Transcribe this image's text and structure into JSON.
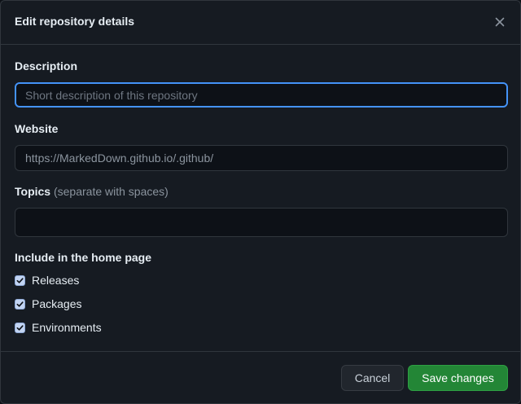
{
  "dialog": {
    "title": "Edit repository details"
  },
  "form": {
    "description": {
      "label": "Description",
      "value": "",
      "placeholder": "Short description of this repository"
    },
    "website": {
      "label": "Website",
      "value": "https://MarkedDown.github.io/.github/"
    },
    "topics": {
      "label": "Topics",
      "hint": "(separate with spaces)",
      "value": ""
    },
    "home_page": {
      "label": "Include in the home page",
      "options": [
        {
          "label": "Releases",
          "checked": true
        },
        {
          "label": "Packages",
          "checked": true
        },
        {
          "label": "Environments",
          "checked": true
        }
      ]
    }
  },
  "footer": {
    "cancel_label": "Cancel",
    "save_label": "Save changes"
  },
  "colors": {
    "background": "#161b22",
    "border": "#30363d",
    "focus_border": "#4493f8",
    "save_button": "#238636",
    "cancel_button": "#21262d"
  },
  "icons": {
    "close": "close-icon",
    "check": "checkmark-icon"
  }
}
